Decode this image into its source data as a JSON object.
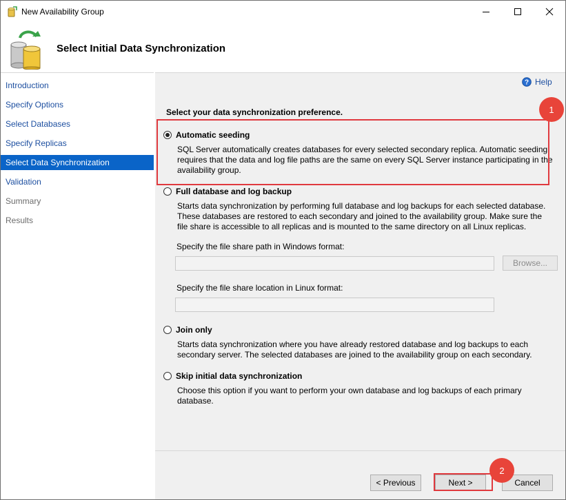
{
  "window": {
    "title": "New Availability Group",
    "controls": {
      "minimize": "minimize-icon",
      "maximize": "maximize-icon",
      "close": "close-icon"
    }
  },
  "header": {
    "title": "Select Initial Data Synchronization"
  },
  "sidebar": {
    "items": [
      {
        "label": "Introduction",
        "state": "link"
      },
      {
        "label": "Specify Options",
        "state": "link"
      },
      {
        "label": "Select Databases",
        "state": "link"
      },
      {
        "label": "Specify Replicas",
        "state": "link"
      },
      {
        "label": "Select Data Synchronization",
        "state": "active"
      },
      {
        "label": "Validation",
        "state": "link"
      },
      {
        "label": "Summary",
        "state": "disabled"
      },
      {
        "label": "Results",
        "state": "disabled"
      }
    ]
  },
  "main": {
    "help_label": "Help",
    "prompt": "Select your data synchronization preference.",
    "options": [
      {
        "label": "Automatic seeding",
        "selected": true,
        "description": "SQL Server automatically creates databases for every selected secondary replica. Automatic seeding requires that the data and log file paths are the same on every SQL Server instance participating in the availability group."
      },
      {
        "label": "Full database and log backup",
        "selected": false,
        "description": "Starts data synchronization by performing full database and log backups for each selected database. These databases are restored to each secondary and joined to the availability group. Make sure the file share is accessible to all replicas and is mounted to the same directory on all Linux replicas."
      },
      {
        "label": "Join only",
        "selected": false,
        "description": "Starts data synchronization where you have already restored database and log backups to each secondary server. The selected databases are joined to the availability group on each secondary."
      },
      {
        "label": "Skip initial data synchronization",
        "selected": false,
        "description": "Choose this option if you want to perform your own database and log backups of each primary database."
      }
    ],
    "windows_path_label": "Specify the file share path in Windows format:",
    "windows_path_value": "",
    "browse_label": "Browse...",
    "linux_path_label": "Specify the file share location in Linux format:",
    "linux_path_value": ""
  },
  "footer": {
    "previous_label": "< Previous",
    "next_label": "Next >",
    "cancel_label": "Cancel"
  },
  "annotations": {
    "callout_1": "1",
    "callout_2": "2",
    "color": "#e0393e"
  }
}
